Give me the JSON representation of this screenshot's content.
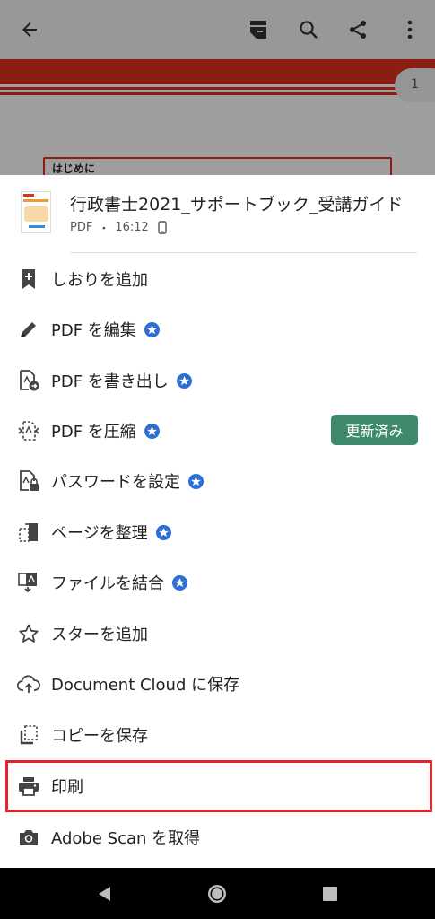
{
  "background_doc": {
    "page_number": "1",
    "heading_text": "はじめに"
  },
  "file": {
    "title": "行政書士2021_サポートブック_受講ガイド",
    "type": "PDF",
    "separator": "・",
    "time": "16:12"
  },
  "menu": {
    "items": [
      {
        "label": "しおりを追加",
        "icon": "bookmark-add-icon"
      },
      {
        "label": "PDF を編集",
        "icon": "pencil-icon"
      },
      {
        "label": "PDF を書き出し",
        "icon": "export-pdf-icon"
      },
      {
        "label": "PDF を圧縮",
        "icon": "compress-pdf-icon"
      },
      {
        "label": "パスワードを設定",
        "icon": "password-pdf-icon"
      },
      {
        "label": "ページを整理",
        "icon": "organize-pages-icon"
      },
      {
        "label": "ファイルを結合",
        "icon": "combine-files-icon"
      },
      {
        "label": "スターを追加",
        "icon": "star-outline-icon"
      },
      {
        "label": "Document Cloud に保存",
        "icon": "cloud-upload-icon"
      },
      {
        "label": "コピーを保存",
        "icon": "copy-icon"
      },
      {
        "label": "印刷",
        "icon": "printer-icon"
      },
      {
        "label": "Adobe Scan を取得",
        "icon": "camera-icon"
      }
    ],
    "updated_badge": "更新済み"
  },
  "colors": {
    "premium_star": "#2d6fd6",
    "updated_badge": "#3e8a6a",
    "highlight": "#e8212b",
    "doc_red": "#e0301e"
  }
}
